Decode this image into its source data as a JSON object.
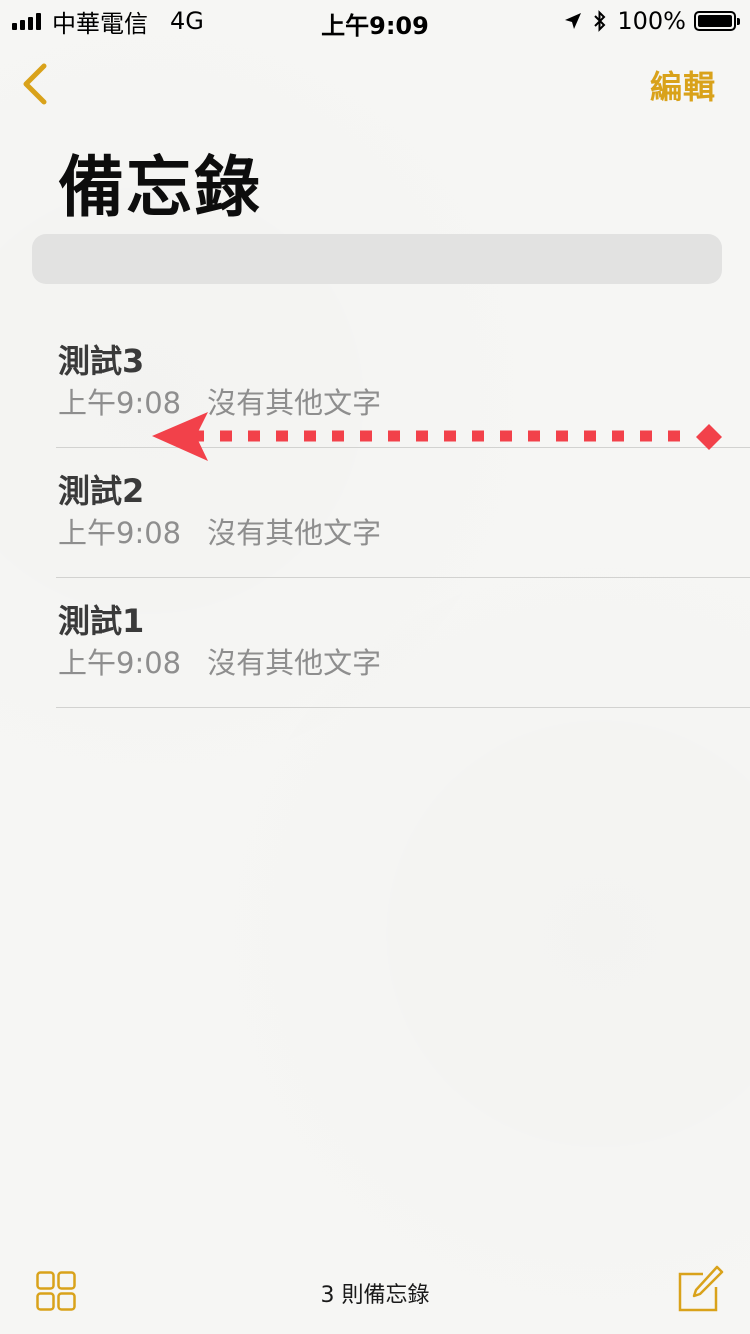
{
  "status_bar": {
    "carrier": "中華電信",
    "network": "4G",
    "time": "上午9:09",
    "battery": "100%",
    "battery_level": 1.0,
    "icons": [
      "signal-icon",
      "location-icon",
      "bluetooth-icon",
      "battery-icon"
    ]
  },
  "nav": {
    "back_icon": "chevron-left-icon",
    "edit_label": "編輯"
  },
  "page": {
    "title": "備忘錄"
  },
  "search": {
    "placeholder": ""
  },
  "notes": [
    {
      "title": "測試3",
      "time": "上午9:08",
      "preview": "沒有其他文字"
    },
    {
      "title": "測試2",
      "time": "上午9:08",
      "preview": "沒有其他文字"
    },
    {
      "title": "測試1",
      "time": "上午9:08",
      "preview": "沒有其他文字"
    }
  ],
  "toolbar": {
    "folders_icon": "grid-icon",
    "count_label": "3 則備忘錄",
    "compose_icon": "compose-icon"
  },
  "colors": {
    "accent": "#d9a21a",
    "background": "#f6f6f4",
    "annotation": "#f2414a"
  }
}
